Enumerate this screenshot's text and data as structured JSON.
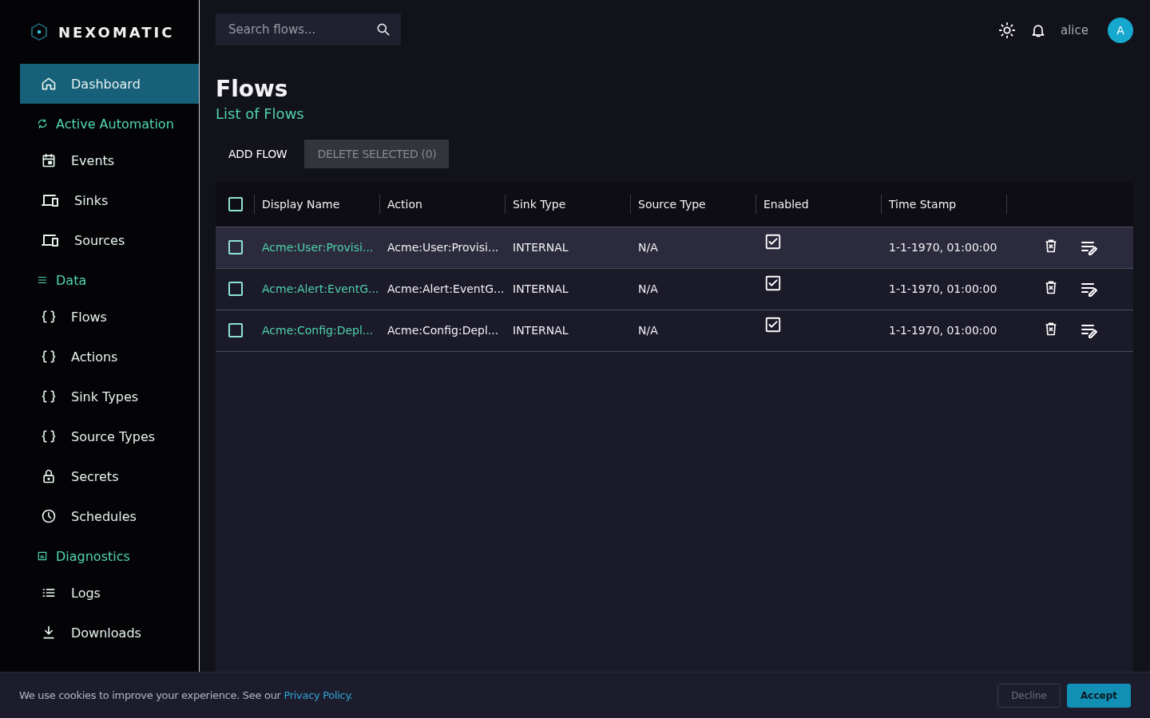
{
  "brand": {
    "name": "NEXOMATIC"
  },
  "sidebar": {
    "items": [
      {
        "kind": "link",
        "label": "Dashboard",
        "selected": true
      },
      {
        "kind": "section",
        "label": "Active Automation"
      },
      {
        "kind": "link",
        "label": "Events",
        "selected": false
      },
      {
        "kind": "link",
        "label": "Sinks",
        "selected": false
      },
      {
        "kind": "link",
        "label": "Sources",
        "selected": false
      },
      {
        "kind": "section",
        "label": "Data"
      },
      {
        "kind": "link",
        "label": "Flows",
        "selected": false
      },
      {
        "kind": "link",
        "label": "Actions",
        "selected": false
      },
      {
        "kind": "link",
        "label": "Sink Types",
        "selected": false
      },
      {
        "kind": "link",
        "label": "Source Types",
        "selected": false
      },
      {
        "kind": "link",
        "label": "Secrets",
        "selected": false
      },
      {
        "kind": "link",
        "label": "Schedules",
        "selected": false
      },
      {
        "kind": "section",
        "label": "Diagnostics"
      },
      {
        "kind": "link",
        "label": "Logs",
        "selected": false
      },
      {
        "kind": "link",
        "label": "Downloads",
        "selected": false
      }
    ]
  },
  "topbar": {
    "search": {
      "placeholder": "Search flows..."
    },
    "user": "alice",
    "avatar": "A"
  },
  "page": {
    "title": "Flows",
    "subtitle": "List of Flows"
  },
  "actions": [
    {
      "label": "ADD FLOW",
      "disabled": false
    },
    {
      "label": "DELETE SELECTED (0)",
      "disabled": true
    }
  ],
  "table": {
    "select_all": {
      "checked": false
    },
    "columns": [
      "Display Name",
      "Action",
      "Sink Type",
      "Source Type",
      "Enabled",
      "Time Stamp"
    ],
    "rows": [
      {
        "checked": false,
        "highlighted": true,
        "display_name": "Acme:User:Provisi...",
        "action": "Acme:User:Provisi...",
        "sink_type": "INTERNAL",
        "source_type": "N/A",
        "enabled": true,
        "time_stamp": "1-1-1970, 01:00:00"
      },
      {
        "checked": false,
        "highlighted": false,
        "display_name": "Acme:Alert:EventG...",
        "action": "Acme:Alert:EventG...",
        "sink_type": "INTERNAL",
        "source_type": "N/A",
        "enabled": true,
        "time_stamp": "1-1-1970, 01:00:00"
      },
      {
        "checked": false,
        "highlighted": false,
        "display_name": "Acme:Config:Depl...",
        "action": "Acme:Config:Depl...",
        "sink_type": "INTERNAL",
        "source_type": "N/A",
        "enabled": true,
        "time_stamp": "1-1-1970, 01:00:00"
      }
    ]
  },
  "cookie_banner": {
    "text": "We use cookies to improve your experience. See our",
    "link": "Privacy Policy.",
    "buttons": [
      {
        "label": "Decline",
        "kind": "secondary"
      },
      {
        "label": "Accept",
        "kind": "primary"
      }
    ]
  }
}
